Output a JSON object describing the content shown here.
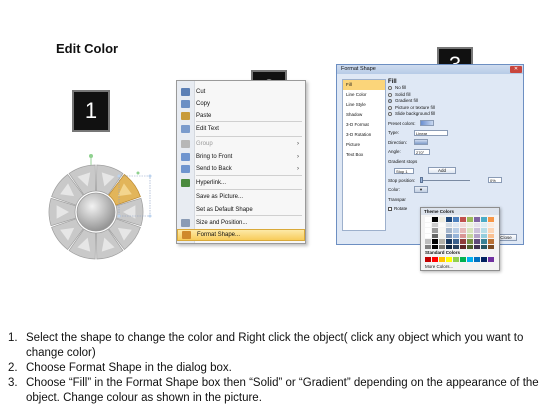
{
  "page_title": "Edit Color",
  "badges": [
    "1",
    "2",
    "3"
  ],
  "wheel": {
    "segment_count": 10,
    "base_color": "#c9c9c9",
    "highlight_color": "#e2b55a"
  },
  "context_menu": {
    "items": [
      {
        "label": "Cut",
        "icon": "scissors-icon",
        "submenu": false,
        "disabled": false
      },
      {
        "label": "Copy",
        "icon": "copy-icon",
        "submenu": false,
        "disabled": false
      },
      {
        "label": "Paste",
        "icon": "paste-icon",
        "submenu": false,
        "disabled": false
      },
      {
        "label": "Edit Text",
        "icon": "edit-text-icon",
        "submenu": false,
        "disabled": false
      },
      {
        "label": "Group",
        "icon": "group-icon",
        "submenu": true,
        "disabled": true
      },
      {
        "label": "Bring to Front",
        "icon": "bring-front-icon",
        "submenu": true,
        "disabled": false
      },
      {
        "label": "Send to Back",
        "icon": "send-back-icon",
        "submenu": true,
        "disabled": false
      },
      {
        "label": "Hyperlink...",
        "icon": "hyperlink-icon",
        "submenu": false,
        "disabled": false
      },
      {
        "label": "Save as Picture...",
        "icon": "",
        "submenu": false,
        "disabled": false
      },
      {
        "label": "Set as Default Shape",
        "icon": "",
        "submenu": false,
        "disabled": false
      },
      {
        "label": "Size and Position...",
        "icon": "size-position-icon",
        "submenu": false,
        "disabled": false
      },
      {
        "label": "Format Shape...",
        "icon": "format-shape-icon",
        "submenu": false,
        "disabled": false,
        "highlighted": true
      }
    ]
  },
  "dialog": {
    "title": "Format Shape",
    "nav": [
      "Fill",
      "Line Color",
      "Line Style",
      "Shadow",
      "3-D Format",
      "3-D Rotation",
      "Picture",
      "Text Box"
    ],
    "selected_nav": "Fill",
    "pane_heading": "Fill",
    "fill_options": [
      {
        "label": "No fill",
        "checked": false
      },
      {
        "label": "Solid fill",
        "checked": false
      },
      {
        "label": "Gradient fill",
        "checked": true
      },
      {
        "label": "Picture or texture fill",
        "checked": false
      },
      {
        "label": "Slide background fill",
        "checked": false
      }
    ],
    "preset_colors_label": "Preset colors:",
    "type_label": "Type:",
    "type_value": "Linear",
    "direction_label": "Direction:",
    "angle_label": "Angle:",
    "angle_value": "270°",
    "gradient_stops_label": "Gradient stops",
    "stop_value": "Stop 1",
    "add_label": "Add",
    "stop_position_label": "Stop position:",
    "stop_position_value": "0%",
    "color_label": "Color:",
    "transparency_label": "Transpar",
    "rotate_label": "Rotate",
    "close_label": "Close"
  },
  "palette": {
    "theme_header": "Theme Colors",
    "standard_header": "Standard Colors",
    "more_colors": "More Colors...",
    "theme_top": [
      "#ffffff",
      "#000000",
      "#eeece1",
      "#1f497d",
      "#4f81bd",
      "#c0504d",
      "#9bbb59",
      "#8064a2",
      "#4bacc6",
      "#f79646"
    ],
    "standard": [
      "#c00000",
      "#ff0000",
      "#ffc000",
      "#ffff00",
      "#92d050",
      "#00b050",
      "#00b0f0",
      "#0070c0",
      "#002060",
      "#7030a0"
    ]
  },
  "steps": [
    {
      "n": "1.",
      "text": "Select the shape to change the color and Right click the object( click any object which you want to change color)"
    },
    {
      "n": "2.",
      "text": "Choose Format Shape in the dialog box."
    },
    {
      "n": "3.",
      "text": "Choose “Fill” in the Format Shape box then “Solid” or “Gradient” depending on the appearance of the object. Change colour as shown in the picture."
    }
  ]
}
